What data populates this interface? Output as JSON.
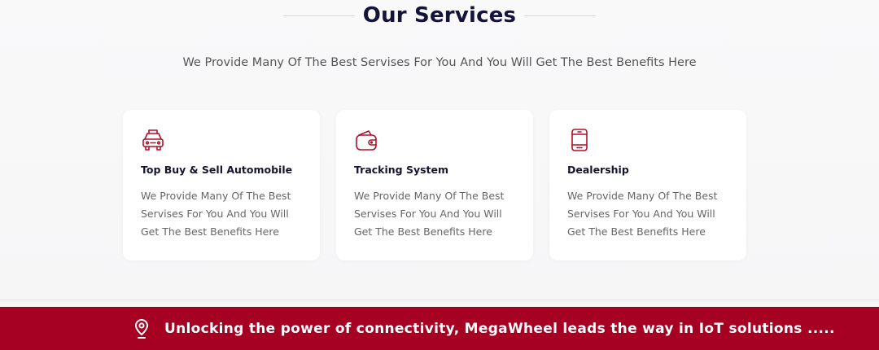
{
  "services": {
    "title": "Our Services",
    "subtitle": "We Provide Many Of The Best Servises For You  And You Will Get The Best Benefits Here",
    "cards": [
      {
        "icon": "car-icon",
        "title": "Top Buy & Sell Automobile",
        "description": "We Provide Many Of The Best Servises For You  And You Will Get The Best Benefits Here"
      },
      {
        "icon": "wallet-icon",
        "title": "Tracking System",
        "description": "We Provide Many Of The Best Servises For You  And You Will Get The Best Benefits Here"
      },
      {
        "icon": "phone-icon",
        "title": "Dealership",
        "description": "We Provide Many Of The Best Servises For You  And You Will Get The Best Benefits Here"
      }
    ]
  },
  "banner": {
    "icon": "location-pin-icon",
    "text": "Unlocking the power of connectivity, MegaWheel leads the way in IoT solutions .....",
    "background": "#a60022"
  },
  "colors": {
    "accent": "#b0102a",
    "heading": "#14133a",
    "body_text": "#666666"
  }
}
